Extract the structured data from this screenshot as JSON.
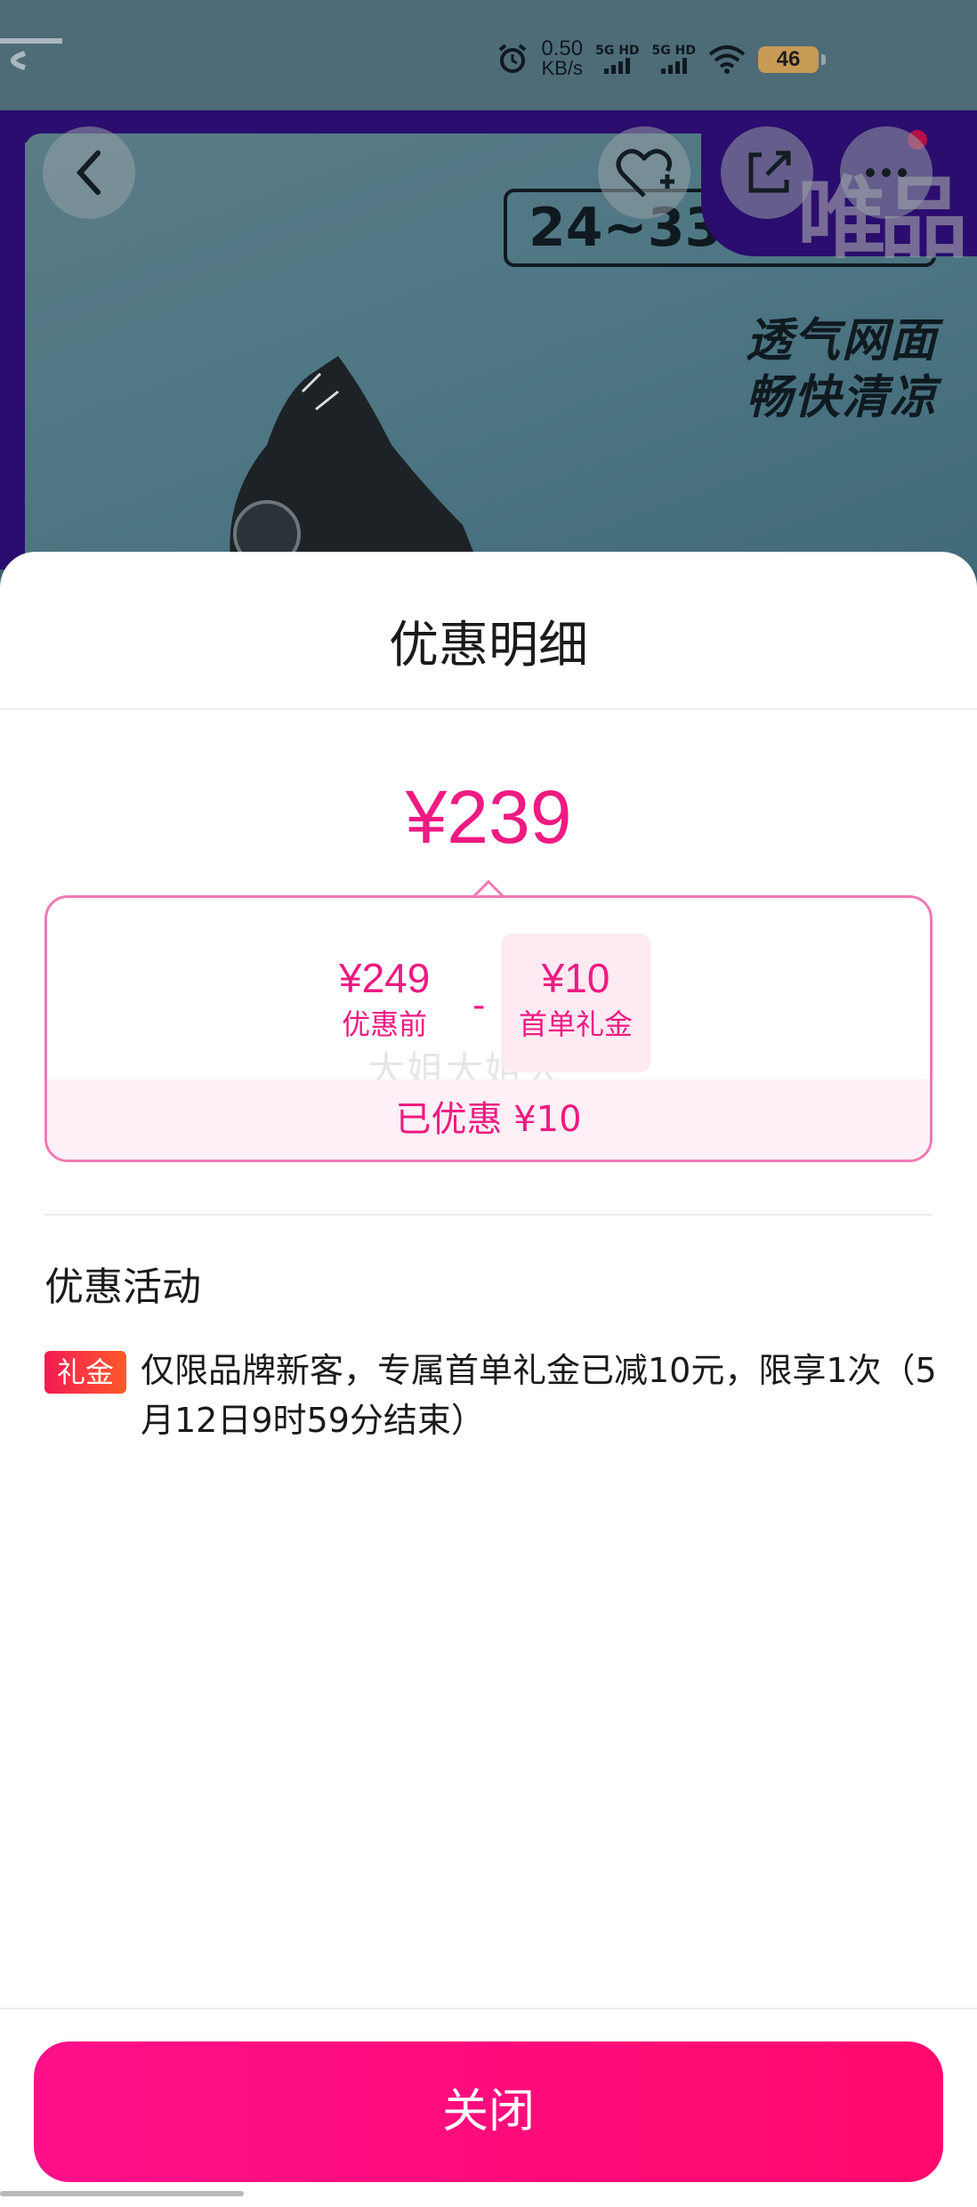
{
  "status_bar": {
    "speed_value": "0.50",
    "speed_unit": "KB/s",
    "net1": "5G HD",
    "net2": "5G HD",
    "battery": "46"
  },
  "background_page": {
    "size_badge": "24~33",
    "promo_line1": "透气网面",
    "promo_line2": "畅快清凉",
    "brand_text": "唯品"
  },
  "sheet": {
    "title": "优惠明细",
    "final_price": "¥239",
    "original_price": "¥249",
    "original_label": "优惠前",
    "operator": "-",
    "discount_amount": "¥10",
    "discount_label": "首单礼金",
    "watermark": "大姐大姐大",
    "saved_text": "已优惠 ¥10",
    "section_title": "优惠活动",
    "activity_tag": "礼金",
    "activity_desc": "仅限品牌新客，专属首单礼金已减10元，限享1次（5月12日9时59分结束）",
    "close_label": "关闭"
  },
  "colors": {
    "accent": "#ef1a82",
    "button": "#ff0f8a",
    "tag": "#f31a52"
  }
}
